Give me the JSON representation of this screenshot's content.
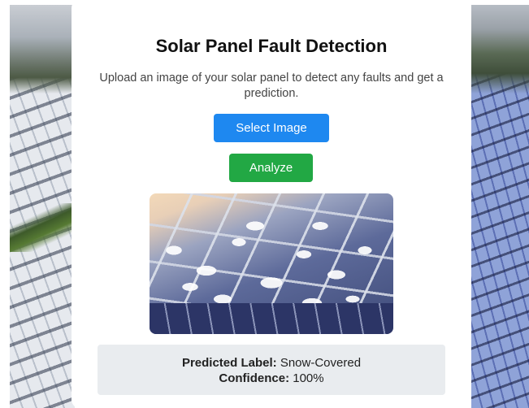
{
  "page": {
    "title": "Solar Panel Fault Detection",
    "subtitle": "Upload an image of your solar panel to detect any faults and get a prediction."
  },
  "buttons": {
    "select_image": "Select Image",
    "analyze": "Analyze"
  },
  "result": {
    "label_caption": "Predicted Label:",
    "label_value": "Snow-Covered",
    "confidence_caption": "Confidence:",
    "confidence_value": "100%"
  },
  "colors": {
    "select_button": "#1e88f0",
    "analyze_button": "#22a844",
    "result_background": "#e9ecef"
  },
  "images": {
    "background": "solar-farm-photo",
    "preview": "snow-covered-solar-panel-photo"
  }
}
